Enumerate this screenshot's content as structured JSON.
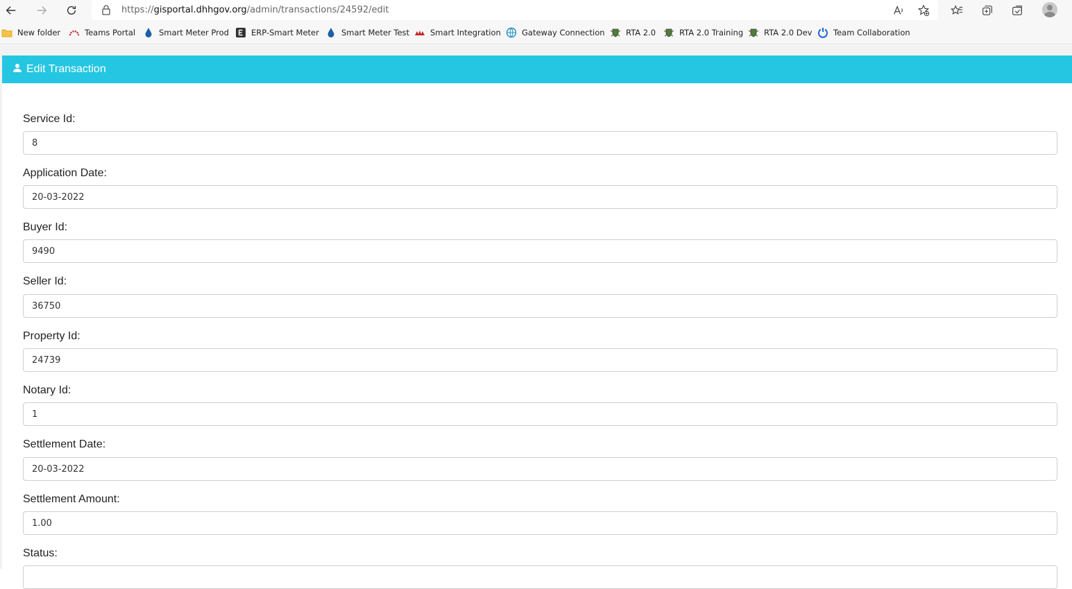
{
  "browser": {
    "url_prefix": "https://",
    "url_host": "gisportal.dhhgov.org",
    "url_path": "/admin/transactions/24592/edit"
  },
  "bookmarks": [
    {
      "label": "New folder",
      "icon": "folder-icon"
    },
    {
      "label": "Teams Portal",
      "icon": "teams-portal-icon"
    },
    {
      "label": "Smart Meter Prod",
      "icon": "water-drop-icon"
    },
    {
      "label": "ERP-Smart Meter",
      "icon": "erp-e-icon"
    },
    {
      "label": "Smart Meter Test",
      "icon": "water-drop-icon"
    },
    {
      "label": "Smart Integration",
      "icon": "integration-icon"
    },
    {
      "label": "Gateway Connection",
      "icon": "gateway-globe-icon"
    },
    {
      "label": "RTA 2.0",
      "icon": "crest-icon"
    },
    {
      "label": "RTA 2.0 Training",
      "icon": "crest-icon"
    },
    {
      "label": "RTA 2.0 Dev",
      "icon": "crest-icon"
    },
    {
      "label": "Team Collaboration",
      "icon": "power-ring-icon"
    }
  ],
  "header": {
    "title": "Edit Transaction"
  },
  "fields": [
    {
      "label": "Service Id:",
      "value": "8"
    },
    {
      "label": "Application Date:",
      "value": "20-03-2022"
    },
    {
      "label": "Buyer Id:",
      "value": "9490"
    },
    {
      "label": "Seller Id:",
      "value": "36750"
    },
    {
      "label": "Property Id:",
      "value": "24739"
    },
    {
      "label": "Notary Id:",
      "value": "1"
    },
    {
      "label": "Settlement Date:",
      "value": "20-03-2022"
    },
    {
      "label": "Settlement Amount:",
      "value": "1.00"
    },
    {
      "label": "Status:",
      "value": ""
    }
  ],
  "colors": {
    "header_bg": "#25c6e2",
    "page_bg": "#f2f2f2"
  }
}
